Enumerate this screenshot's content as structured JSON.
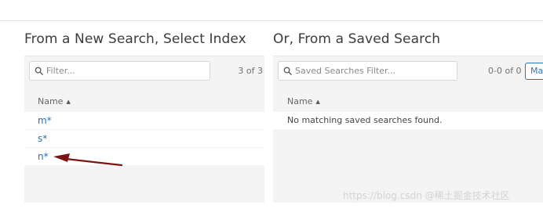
{
  "left": {
    "heading": "From a New Search, Select Index",
    "filter_placeholder": "Filter...",
    "count": "3 of 3",
    "column_header": "Name",
    "rows": [
      "m*",
      "s*",
      "n*"
    ]
  },
  "right": {
    "heading": "Or, From a Saved Search",
    "filter_placeholder": "Saved Searches Filter...",
    "count": "0-0 of 0",
    "manage_button": "Ma",
    "column_header": "Name",
    "empty_message": "No matching saved searches found."
  },
  "watermark": "https://blog.csdn @稀土掘金技术社区",
  "colors": {
    "link": "#2f6fa8",
    "panel_bg": "#f4f4f4",
    "arrow": "#7d1414",
    "button": "#2f78b8"
  },
  "icons": [
    "search-icon",
    "sort-ascending-icon",
    "annotation-arrow"
  ]
}
